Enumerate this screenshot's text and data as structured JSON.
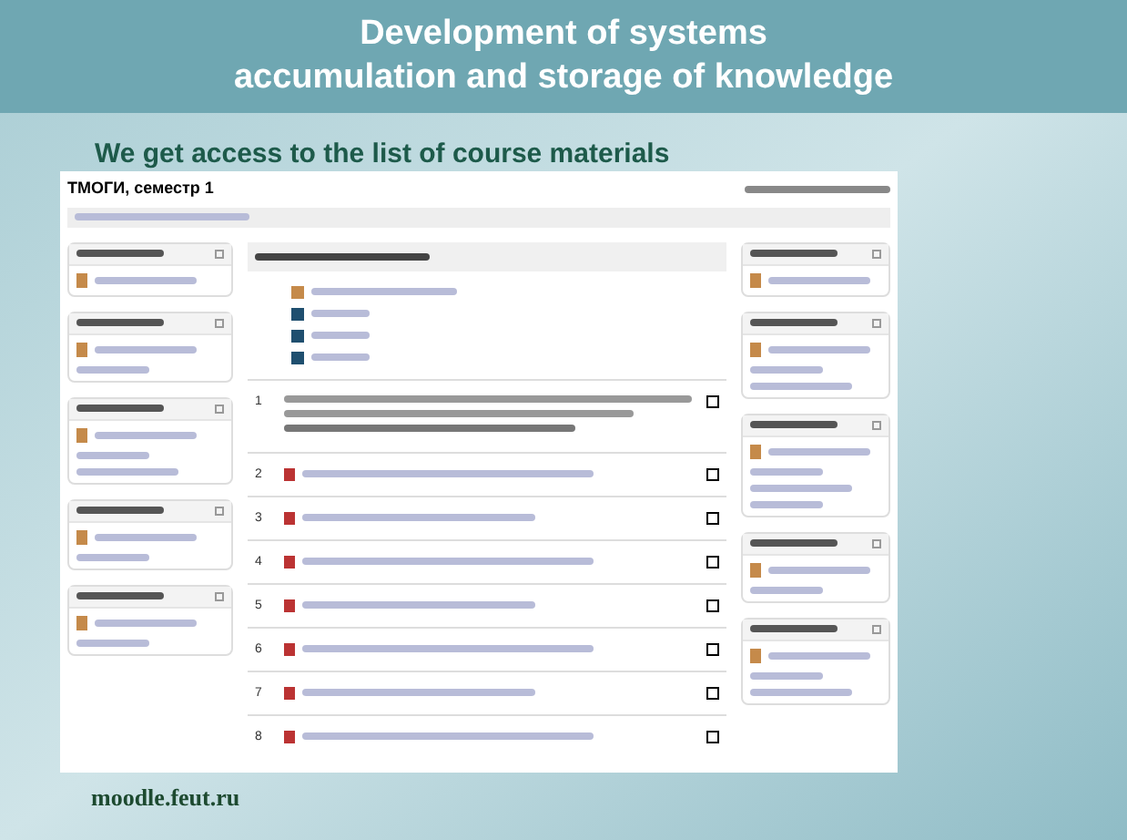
{
  "slide": {
    "title_lines": [
      "Development of systems",
      "accumulation and storage of knowledge"
    ],
    "subtitle": "We get access to the list of course materials",
    "footer": "moodle.feut.ru"
  },
  "page": {
    "course_title": "ТМОГИ, семестр 1",
    "topics": [
      {
        "number": "1",
        "checked": false
      },
      {
        "number": "2",
        "checked": false
      },
      {
        "number": "3",
        "checked": false
      },
      {
        "number": "4",
        "checked": false
      },
      {
        "number": "5",
        "checked": false
      },
      {
        "number": "6",
        "checked": false
      },
      {
        "number": "7",
        "checked": false
      },
      {
        "number": "8",
        "checked": false
      }
    ]
  }
}
